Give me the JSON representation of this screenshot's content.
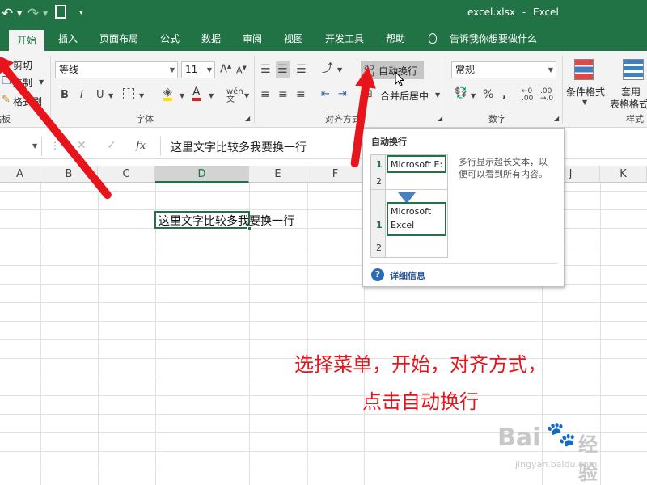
{
  "title_bar": {
    "filename": "excel.xlsx",
    "separator": "-",
    "app_name": "Excel",
    "undo_icon": "undo-icon",
    "redo_icon": "redo-icon",
    "print_preview_icon": "print-preview-icon"
  },
  "tabs": [
    {
      "label": "开始",
      "active": true
    },
    {
      "label": "插入"
    },
    {
      "label": "页面布局"
    },
    {
      "label": "公式"
    },
    {
      "label": "数据"
    },
    {
      "label": "审阅"
    },
    {
      "label": "视图"
    },
    {
      "label": "开发工具"
    },
    {
      "label": "帮助"
    }
  ],
  "tell_me": "告诉我你想要做什么",
  "ribbon": {
    "clipboard": {
      "cut": "剪切",
      "copy": "复制",
      "format_painter": "格式刷",
      "label": "剪贴板"
    },
    "font": {
      "name": "等线",
      "size": "11",
      "bold": "B",
      "italic": "I",
      "underline": "U",
      "label": "字体"
    },
    "alignment": {
      "wrap_text": "自动换行",
      "merge_center": "合并后居中",
      "label": "对齐方式"
    },
    "number": {
      "format": "常规",
      "percent": "%",
      "label": "数字"
    },
    "styles": {
      "conditional": "条件格式",
      "table_format_line1": "套用",
      "table_format_line2": "表格格式",
      "label": "样式"
    }
  },
  "formula_bar": {
    "fx": "fx",
    "content": "这里文字比较多我要换一行"
  },
  "columns": [
    "A",
    "B",
    "C",
    "D",
    "E",
    "F",
    "J",
    "K"
  ],
  "selected_column": "D",
  "cell": {
    "value": "这里文字比较多我要换一行"
  },
  "tooltip": {
    "title": "自动换行",
    "desc_line1": "多行显示超长文本，以",
    "desc_line2": "便可以看到所有内容。",
    "before_row1": "1",
    "before_row2": "2",
    "before_text": "Microsoft E:",
    "after_row1": "1",
    "after_row2": "2",
    "after_text_line1": "Microsoft",
    "after_text_line2": "Excel",
    "more_info": "详细信息"
  },
  "annotation": {
    "line1": "选择菜单，开始，对齐方式，",
    "line2": "点击自动换行"
  },
  "watermark": {
    "brand": "Bai",
    "brand2": "经验",
    "url": "jingyan.baidu.com"
  },
  "colors": {
    "excel_green": "#217346",
    "arrow_red": "#e8141b",
    "annotation_red": "#e5151c"
  }
}
